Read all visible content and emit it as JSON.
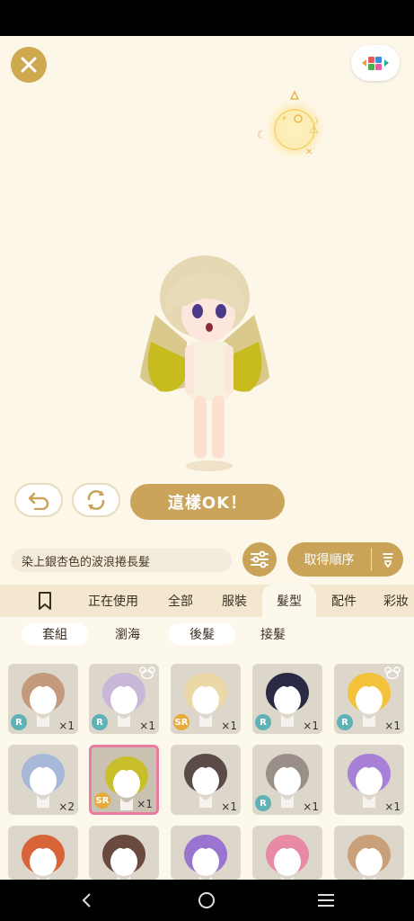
{
  "header": {
    "close_icon": "close-icon",
    "tile_icon": "color-blocks-icon"
  },
  "actions": {
    "undo_icon": "undo-icon",
    "rotate_icon": "rotate-icon",
    "ok_label": "這樣OK！"
  },
  "item_info": {
    "name": "染上銀杏色的波浪捲長髮",
    "filter_icon": "sliders-icon",
    "sort_label": "取得順序",
    "sort_icon": "sort-desc-icon"
  },
  "tabs": [
    {
      "label": "bookmark-icon"
    },
    {
      "label": "正在使用"
    },
    {
      "label": "全部"
    },
    {
      "label": "服裝"
    },
    {
      "label": "髮型"
    },
    {
      "label": "配件"
    },
    {
      "label": "彩妝"
    }
  ],
  "subtabs": [
    {
      "label": "套組"
    },
    {
      "label": "瀏海"
    },
    {
      "label": "後髮"
    },
    {
      "label": "接髮"
    }
  ],
  "items": [
    {
      "rarity": "R",
      "qty": "×1",
      "hair": "#c49a7c",
      "bear": false
    },
    {
      "rarity": "R",
      "qty": "×1",
      "hair": "#c8b7d8",
      "bear": true
    },
    {
      "rarity": "SR",
      "qty": "×1",
      "hair": "#ecd8a6",
      "bear": false
    },
    {
      "rarity": "R",
      "qty": "×1",
      "hair": "#2a2a44",
      "bear": false
    },
    {
      "rarity": "R",
      "qty": "×1",
      "hair": "#f2c23a",
      "bear": true
    },
    {
      "rarity": "",
      "qty": "×2",
      "hair": "#a7b8d8",
      "bear": false
    },
    {
      "rarity": "SR",
      "qty": "×1",
      "hair": "#c9bf2a",
      "bear": false
    },
    {
      "rarity": "",
      "qty": "×1",
      "hair": "#5a4a48",
      "bear": false
    },
    {
      "rarity": "R",
      "qty": "×1",
      "hair": "#9a8f88",
      "bear": false
    },
    {
      "rarity": "",
      "qty": "×1",
      "hair": "#a980d8",
      "bear": false
    }
  ],
  "colors": {
    "gold": "#caa45a",
    "r_badge": "#5fb2b6",
    "sr_badge": "#e6a93a",
    "selected": "#ea7aa0"
  }
}
